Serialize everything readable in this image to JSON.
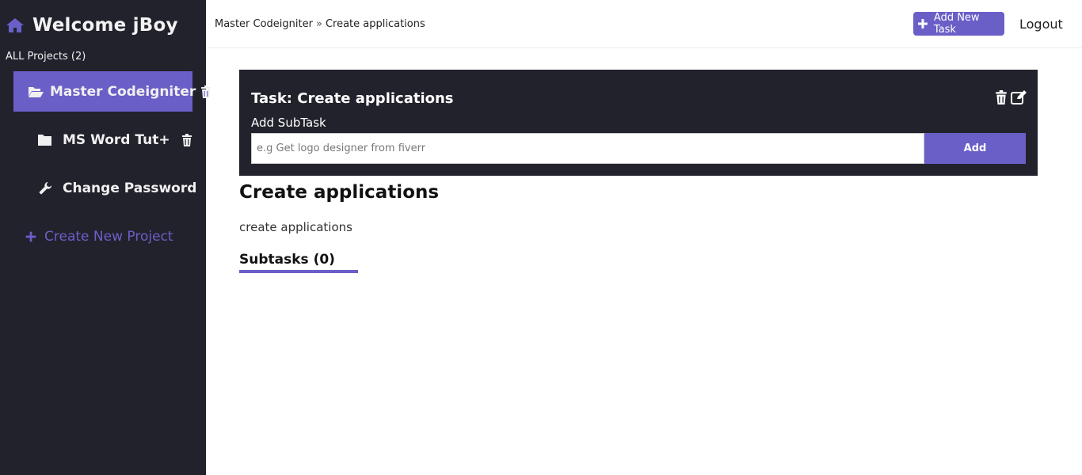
{
  "sidebar": {
    "title": "Welcome jBoy",
    "icon": "home-icon",
    "all_projects_label": "ALL Projects (2)",
    "projects": [
      {
        "label": "Master Codeigniter",
        "icon": "folder-open-icon",
        "active": true
      },
      {
        "label": "MS Word Tut+",
        "icon": "folder-icon",
        "active": false
      }
    ],
    "change_password": {
      "label": "Change Password",
      "icon": "wrench-icon"
    },
    "create_project": {
      "label": "Create New Project",
      "icon": "plus-icon"
    }
  },
  "topbar": {
    "breadcrumb": {
      "project": "Master Codeigniter",
      "separator": "»",
      "task": "Create applications"
    },
    "add_task_label": "Add New Task",
    "logout_label": "Logout"
  },
  "task_panel": {
    "title": "Task: Create applications",
    "add_subtask_label": "Add SubTask",
    "input_placeholder": "e.g Get logo designer from fiverr",
    "input_value": "",
    "add_button_label": "Add"
  },
  "content": {
    "title": "Create applications",
    "description": "create applications",
    "subtasks_heading": "Subtasks (0)"
  },
  "colors": {
    "accent": "#6a5fc7",
    "sidebar_bg": "#22222d",
    "panel_bg": "#22222d"
  }
}
